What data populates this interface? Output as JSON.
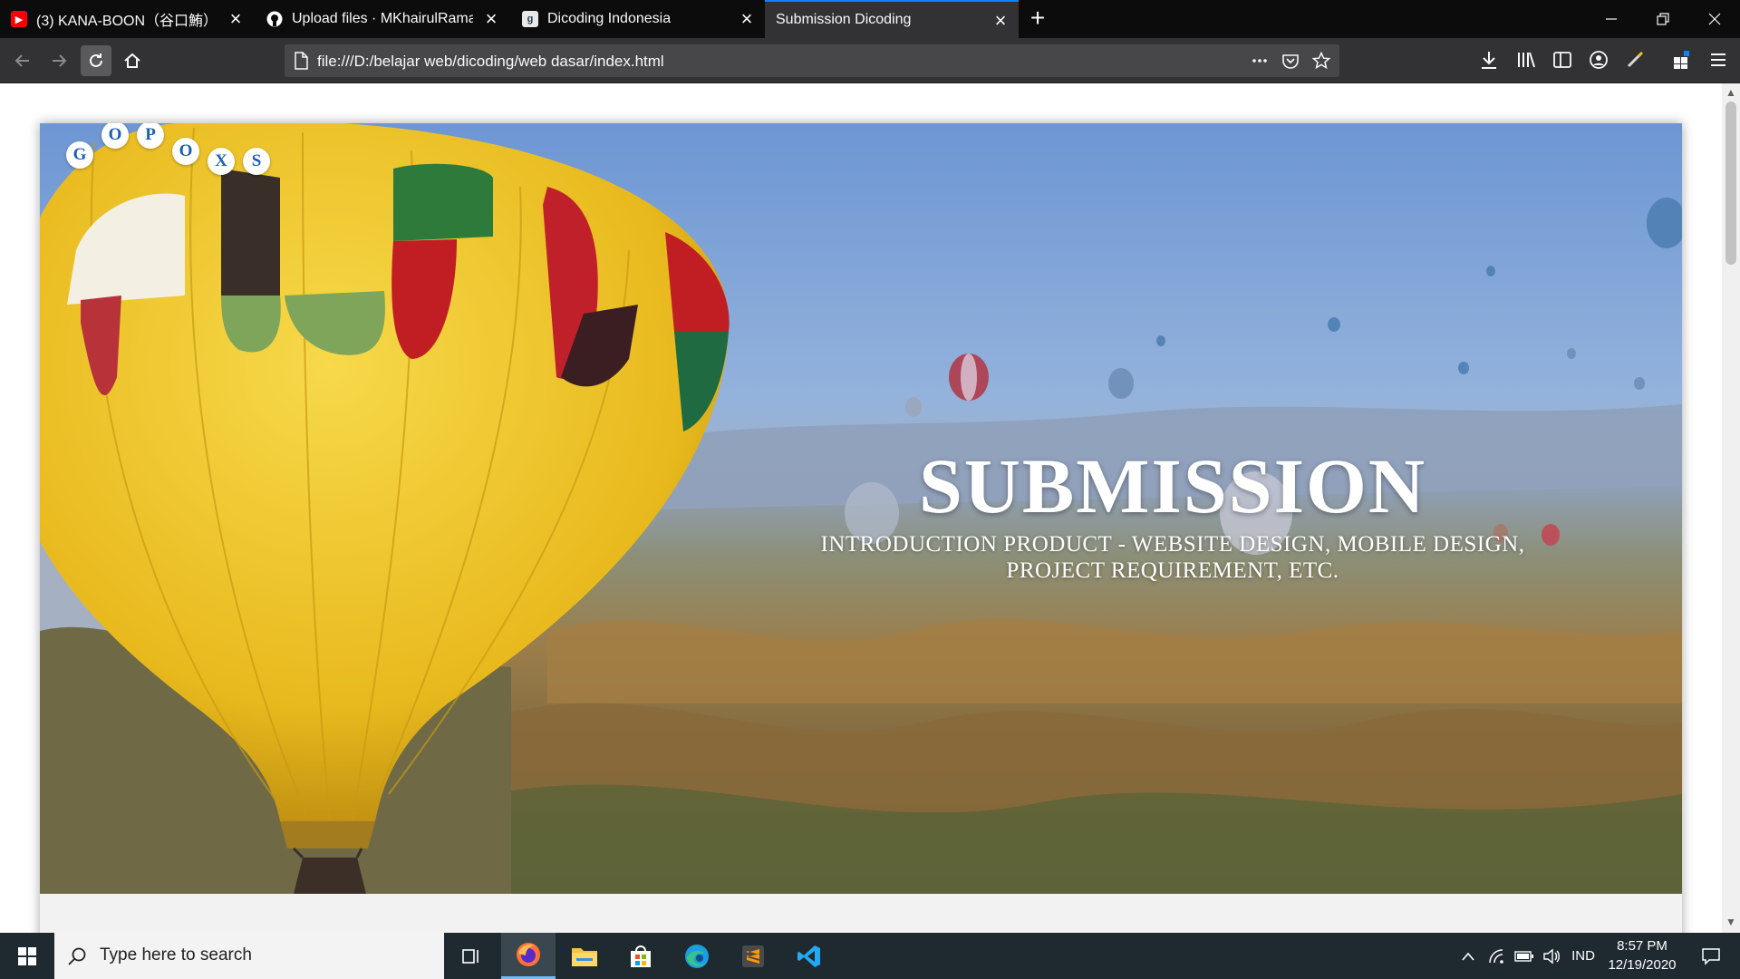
{
  "browser": {
    "tabs": [
      {
        "label": "(3) KANA-BOON（谷口鮪）× ",
        "favicon": "youtube-icon",
        "color": "#ff0000"
      },
      {
        "label": "Upload files · MKhairulRamadh",
        "favicon": "github-icon",
        "color": "#ffffff"
      },
      {
        "label": "Dicoding Indonesia",
        "favicon": "dicoding-icon",
        "color": "#2d3e50"
      },
      {
        "label": "Submission Dicoding",
        "favicon": "",
        "color": ""
      }
    ],
    "active_tab": 3,
    "url": "file:///D:/belajar web/dicoding/web dasar/index.html"
  },
  "page": {
    "logo_letters": [
      "G",
      "O",
      "P",
      "O",
      "X",
      "S"
    ],
    "hero": {
      "title": "SUBMISSION",
      "subtitle": "INTRODUCTION PRODUCT - WEBSITE DESIGN, MOBILE DESIGN, PROJECT REQUIREMENT, ETC."
    }
  },
  "taskbar": {
    "search_placeholder": "Type here to search",
    "language": "IND",
    "time": "8:57 PM",
    "date": "12/19/2020"
  },
  "colors": {
    "accent": "#0a84ff",
    "logo_text": "#1a5fb4",
    "taskbar_bg": "#1f2a30"
  }
}
